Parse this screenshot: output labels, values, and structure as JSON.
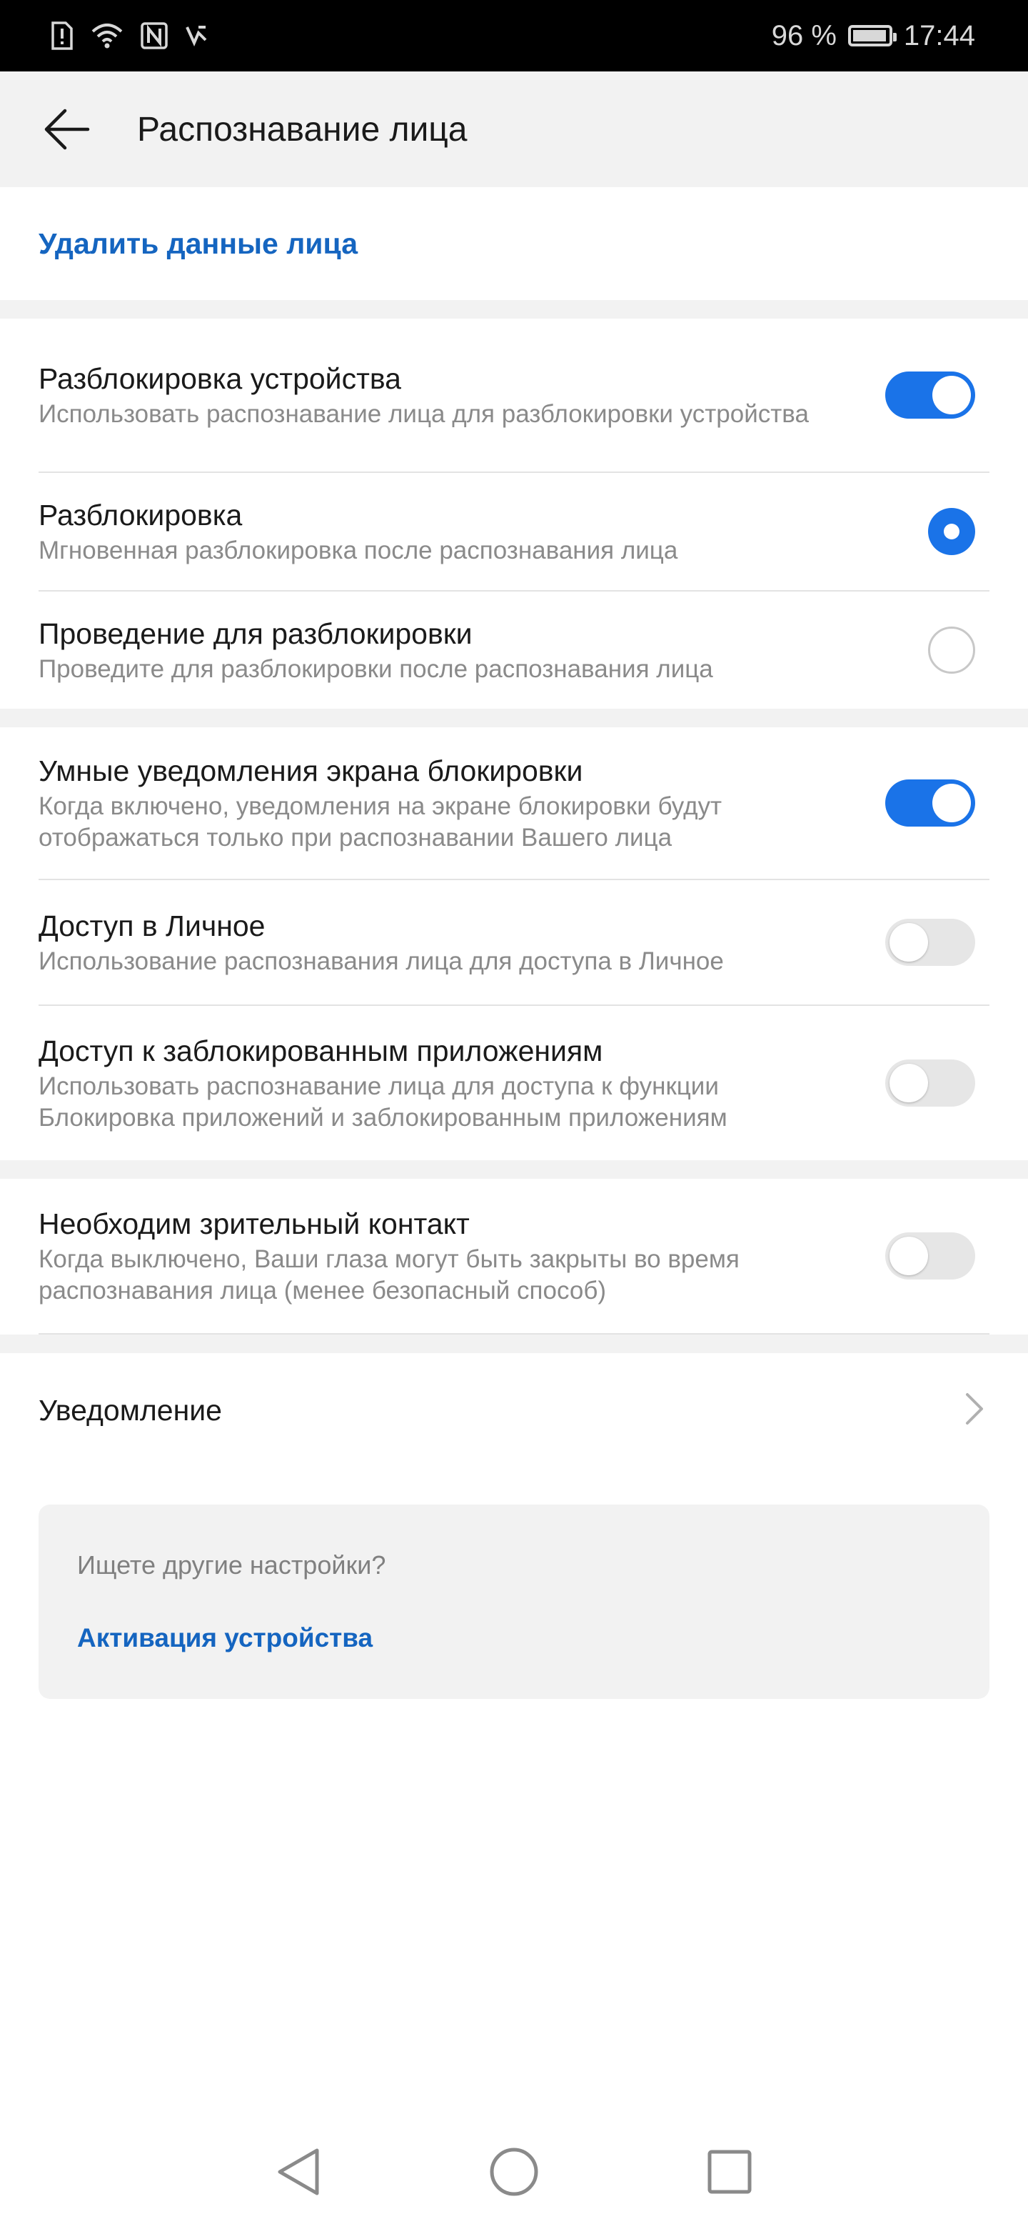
{
  "status_bar": {
    "battery_text": "96 %",
    "battery_level": 0.96,
    "time": "17:44",
    "icons": [
      "sim-alert-icon",
      "wifi-icon",
      "nfc-icon",
      "data-saver-icon"
    ]
  },
  "header": {
    "title": "Распознавание лица",
    "back_icon": "arrow-left-icon"
  },
  "delete_face_data": "Удалить данные лица",
  "sections": {
    "unlock": {
      "device_unlock": {
        "title": "Разблокировка устройства",
        "subtitle": "Использовать распознавание лица для разблокировки устройства",
        "enabled": true
      },
      "direct_unlock": {
        "title": "Разблокировка",
        "subtitle": "Мгновенная разблокировка после распознавания лица",
        "selected": true
      },
      "swipe_unlock": {
        "title": "Проведение для разблокировки",
        "subtitle": "Проведите для разблокировки после распознавания лица",
        "selected": false
      }
    },
    "access": {
      "smart_notifications": {
        "title": "Умные уведомления экрана блокировки",
        "subtitle": "Когда включено, уведомления на экране блокировки будут отображаться только при распознавании Вашего лица",
        "enabled": true
      },
      "private_space": {
        "title": "Доступ в Личное",
        "subtitle": "Использование распознавания лица для доступа в Личное",
        "enabled": false
      },
      "locked_apps": {
        "title": "Доступ к заблокированным приложениям",
        "subtitle": "Использовать распознавание лица для доступа к функции Блокировка приложений и заблокированным приложениям",
        "enabled": false
      }
    },
    "attention": {
      "eye_contact": {
        "title": "Необходим зрительный контакт",
        "subtitle": "Когда выключено, Ваши глаза могут быть закрыты во время распознавания лица (менее безопасный способ)",
        "enabled": false
      }
    }
  },
  "notification_row": {
    "title": "Уведомление",
    "icon": "chevron-right-icon"
  },
  "suggestion_card": {
    "title": "Ищете другие настройки?",
    "link": "Активация устройства"
  },
  "nav_bar": {
    "icons": [
      "back-triangle-icon",
      "home-circle-icon",
      "recents-square-icon"
    ]
  },
  "colors": {
    "accent": "#1a73e8",
    "link": "#1565c0",
    "switch_off": "#e6e6e6",
    "section_gap": "#f2f2f2"
  }
}
